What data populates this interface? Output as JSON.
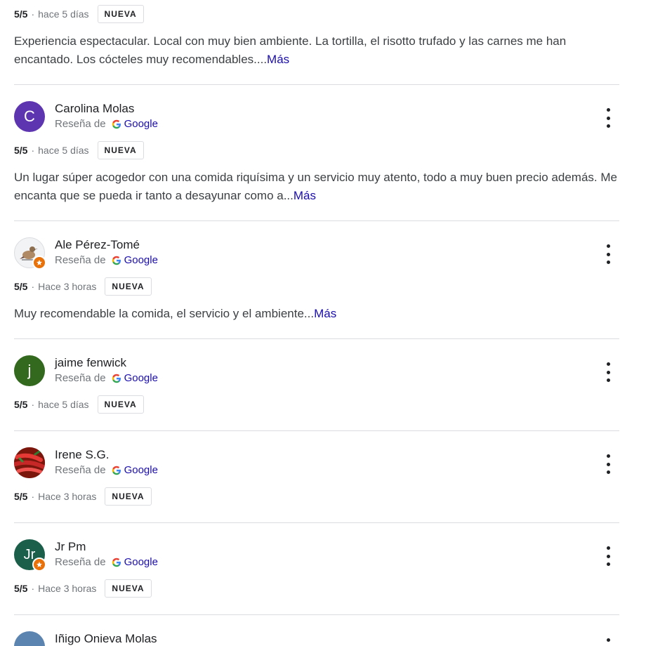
{
  "colors": {
    "link": "#1a0dab",
    "divider": "#dadce0",
    "muted": "#70757a",
    "guide_badge": "#e8710a"
  },
  "labels": {
    "source_prefix": "Reseña de",
    "source_name": "Google",
    "more": "Más",
    "new_badge": "NUEVA"
  },
  "top_review": {
    "rating": "5/5",
    "time": "hace 5 días",
    "badge": "NUEVA",
    "text": "Experiencia espectacular. Local con muy bien ambiente. La tortilla, el risotto trufado y las carnes me han encantado. Los cócteles muy recomendables....",
    "more": "Más"
  },
  "reviews": [
    {
      "name": "Carolina Molas",
      "avatar_letter": "C",
      "avatar_color": "#5e35b1",
      "source_prefix": "Reseña de",
      "source_name": "Google",
      "rating": "5/5",
      "time": "hace 5 días",
      "badge": "NUEVA",
      "text": "Un lugar súper acogedor con una comida riquísima y un servicio muy atento, todo a muy buen precio además. Me encanta que se pueda ir tanto a desayunar como a...",
      "more": "Más"
    },
    {
      "name": "Ale Pérez-Tomé",
      "avatar_icon": "photo-avatar-icon",
      "source_prefix": "Reseña de",
      "source_name": "Google",
      "rating": "5/5",
      "time": "Hace 3 horas",
      "badge": "NUEVA",
      "text": "Muy recomendable la comida, el servicio y el ambiente...",
      "more": "Más"
    },
    {
      "name": "jaime fenwick",
      "avatar_letter": "j",
      "avatar_color": "#33691e",
      "source_prefix": "Reseña de",
      "source_name": "Google",
      "rating": "5/5",
      "time": "hace 5 días",
      "badge": "NUEVA"
    },
    {
      "name": "Irene S.G.",
      "avatar_icon": "chili-peppers-avatar-icon",
      "source_prefix": "Reseña de",
      "source_name": "Google",
      "rating": "5/5",
      "time": "Hace 3 horas",
      "badge": "NUEVA"
    },
    {
      "name": "Jr Pm",
      "avatar_letter": "Jr",
      "avatar_color": "#1b5e4a",
      "source_prefix": "Reseña de",
      "source_name": "Google",
      "rating": "5/5",
      "time": "Hace 3 horas",
      "badge": "NUEVA"
    },
    {
      "name": "Iñigo Onieva Molas",
      "avatar_icon": "photo-avatar-icon"
    }
  ]
}
